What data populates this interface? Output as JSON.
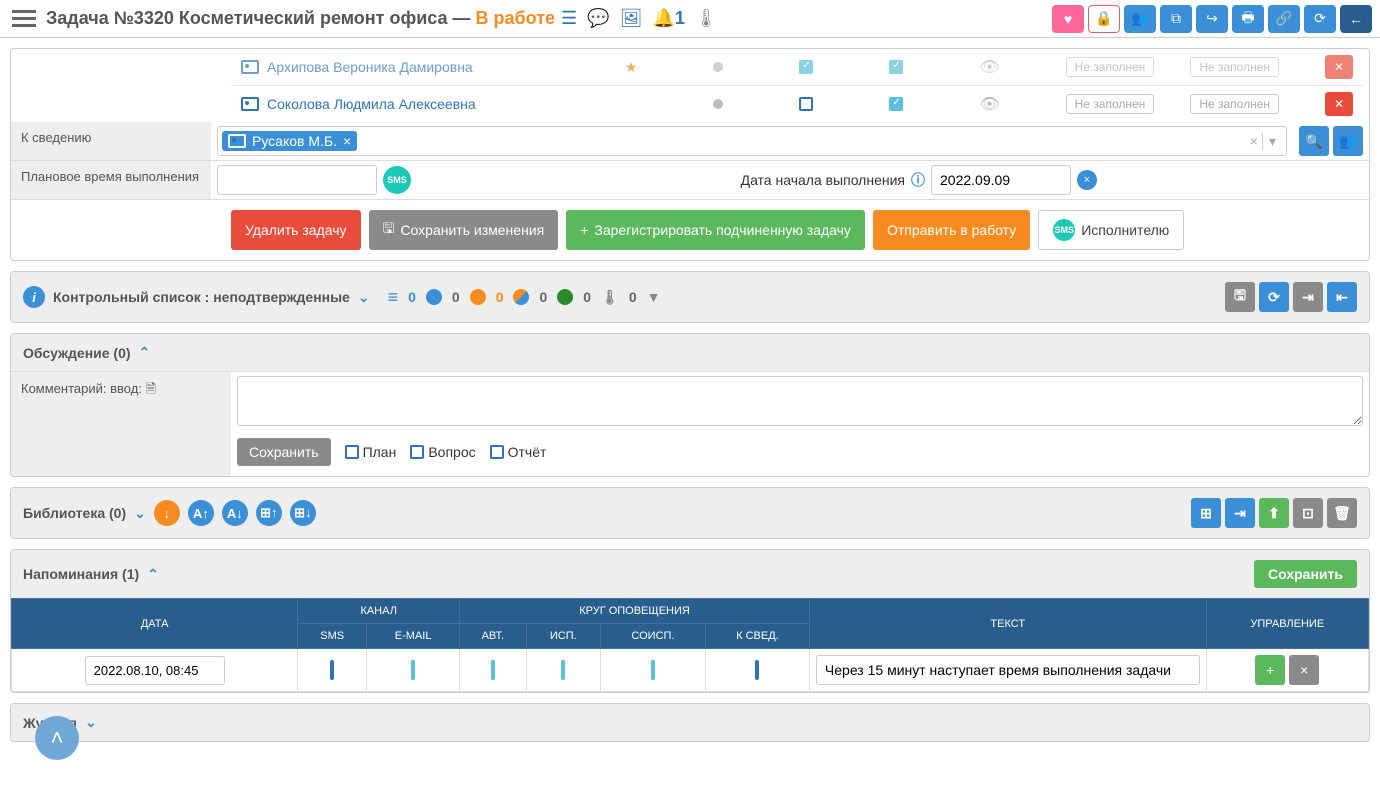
{
  "header": {
    "title_prefix": "Задача №3320 Косметический ремонт офиса — ",
    "status": "В работе",
    "bell_count": "1"
  },
  "persons": [
    {
      "name": "Архипова Вероника Дамировна",
      "checked2": true,
      "checked3": true,
      "nf1": "Не заполнен",
      "nf2": "Не заполнен"
    },
    {
      "name": "Соколова Людмила Алексеевна",
      "checked2": false,
      "checked3": true,
      "nf1": "Не заполнен",
      "nf2": "Не заполнен"
    }
  ],
  "fyi": {
    "label": "К сведению",
    "chip": "Русаков М.Б."
  },
  "plan_time": {
    "label": "Плановое время выполнения"
  },
  "start_date": {
    "label": "Дата начала выполнения",
    "value": "2022.09.09"
  },
  "buttons": {
    "delete": "Удалить задачу",
    "save": "Сохранить изменения",
    "register_sub": "Зарегистрировать подчиненную задачу",
    "send_work": "Отправить в работу",
    "to_executor": "Исполнителю"
  },
  "checklist": {
    "title": "Контрольный список : неподтвержденные",
    "counts": [
      "0",
      "0",
      "0",
      "0",
      "0",
      "0"
    ]
  },
  "discussion": {
    "title": "Обсуждение (0)",
    "comment_label": "Комментарий: ввод:",
    "save": "Сохранить",
    "plan": "План",
    "question": "Вопрос",
    "report": "Отчёт"
  },
  "library": {
    "title": "Библиотека (0)"
  },
  "reminders": {
    "title": "Напоминания (1)",
    "save": "Сохранить",
    "headers": {
      "date": "ДАТА",
      "channel": "КАНАЛ",
      "sms": "SMS",
      "email": "E-MAIL",
      "circle": "КРУГ ОПОВЕЩЕНИЯ",
      "avt": "АВТ.",
      "isp": "ИСП.",
      "soisp": "СОИСП.",
      "ksved": "К СВЕД.",
      "text": "ТЕКСТ",
      "control": "УПРАВЛЕНИЕ"
    },
    "row": {
      "datetime": "2022.08.10, 08:45",
      "text": "Через 15 минут наступает время выполнения задачи"
    }
  },
  "journal": {
    "title": "Журнал"
  }
}
